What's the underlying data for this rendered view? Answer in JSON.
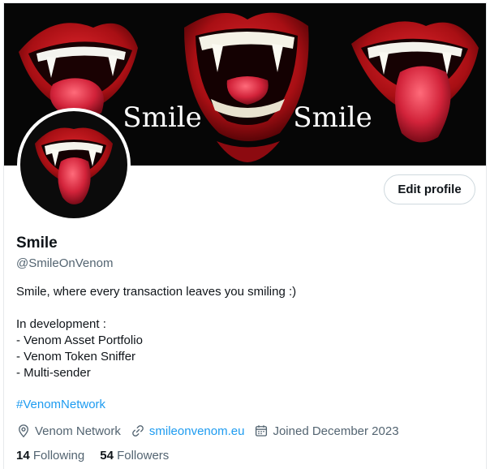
{
  "banner": {
    "text_left": "Smile",
    "text_right": "Smile"
  },
  "profile": {
    "name": "Smile",
    "handle": "@SmileOnVenom",
    "edit_button": "Edit profile",
    "bio_lines": [
      "Smile, where every transaction leaves you smiling :)",
      "",
      "In development :",
      "- Venom Asset Portfolio",
      "- Venom Token Sniffer",
      "- Multi-sender",
      ""
    ],
    "hashtag": "#VenomNetwork",
    "location": "Venom Network",
    "website": "smileonvenom.eu",
    "joined": "Joined December 2023",
    "following_count": "14",
    "following_label": "Following",
    "followers_count": "54",
    "followers_label": "Followers"
  },
  "icons": {
    "location": "location-pin-icon",
    "link": "link-icon",
    "calendar": "calendar-icon"
  },
  "colors": {
    "accent": "#1d9bf0",
    "text": "#0f1419",
    "muted": "#536471",
    "lips_red": "#c4161c",
    "banner_bg": "#060606"
  }
}
